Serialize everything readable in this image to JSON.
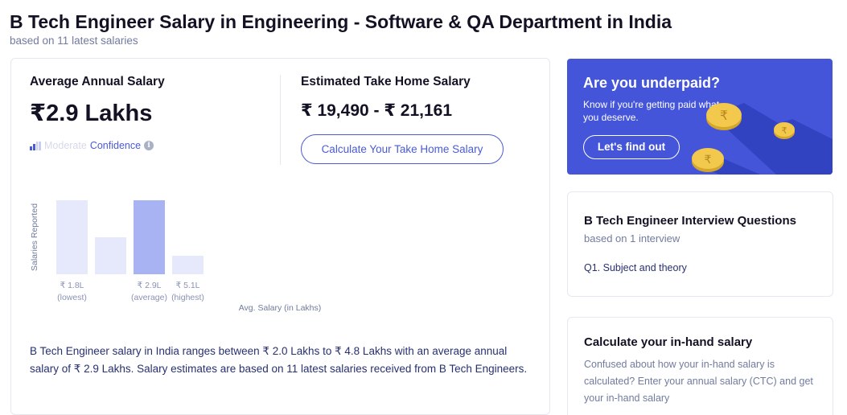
{
  "page": {
    "title": "B Tech Engineer Salary in Engineering - Software & QA Department in India",
    "subtitle": "based on 11 latest salaries"
  },
  "stats": {
    "avg_label": "Average Annual Salary",
    "avg_value": "₹2.9 Lakhs",
    "confidence_level": "Moderate",
    "confidence_word": "Confidence",
    "info_icon_glyph": "i",
    "take_home_label": "Estimated Take Home Salary",
    "take_home_value": "₹ 19,490 - ₹ 21,161",
    "calc_button": "Calculate Your Take Home Salary"
  },
  "chart_data": {
    "type": "bar",
    "ylabel": "Salaries Reported",
    "xlabel": "Avg. Salary (in Lakhs)",
    "categories": [
      "₹ 1.8L",
      "",
      "₹ 2.9L",
      "₹ 5.1L"
    ],
    "category_notes": [
      "(lowest)",
      "",
      "(average)",
      "(highest)"
    ],
    "values": [
      4,
      2,
      4,
      1
    ],
    "highlight_index": 2,
    "colors": {
      "bar": "#e6e9fb",
      "highlight": "#a8b3f4"
    }
  },
  "description": "B Tech Engineer salary in India ranges between ₹ 2.0 Lakhs to ₹ 4.8 Lakhs with an average annual salary of ₹ 2.9 Lakhs. Salary estimates are based on 11 latest salaries received from B Tech Engineers.",
  "promo": {
    "title": "Are you underpaid?",
    "text": "Know if you're getting paid what you deserve.",
    "button": "Let's find out",
    "coin_glyph": "₹"
  },
  "interview": {
    "title": "B Tech Engineer Interview Questions",
    "subtitle": "based on 1 interview",
    "question": "Q1.  Subject and theory"
  },
  "inhand": {
    "title": "Calculate your in-hand salary",
    "text": "Confused about how your in-hand salary is calculated? Enter your annual salary (CTC) and get your in-hand salary"
  },
  "colors": {
    "accent": "#4a5bd4",
    "promo_bg": "#4455d9",
    "coin": "#f2c94c"
  }
}
